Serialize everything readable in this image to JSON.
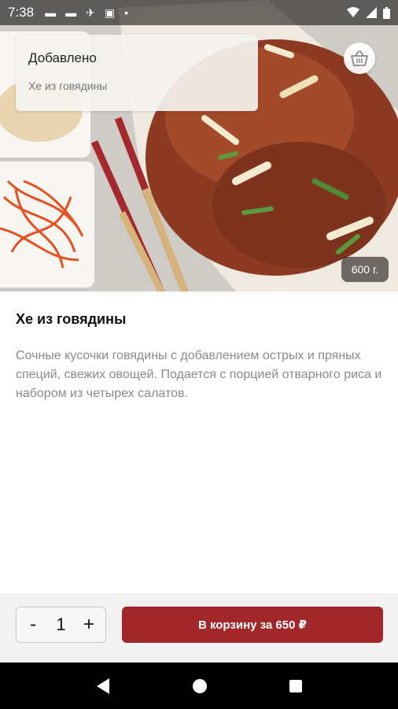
{
  "status_bar": {
    "time": "7:38"
  },
  "toast": {
    "title": "Добавлено",
    "subtitle": "Хе из говядины"
  },
  "hero": {
    "weight": "600 г."
  },
  "product": {
    "title": "Хе из говядины",
    "description": "Сочные кусочки говядины с добавлением острых и пряных специй, свежих овощей. Подается с порцией отварного риса и набором из четырех салатов."
  },
  "order": {
    "minus": "-",
    "quantity": "1",
    "plus": "+",
    "add_to_cart_label": "В корзину за 650 ₽"
  },
  "icons": {
    "basket": "basket-icon",
    "back": "back-icon",
    "home": "home-icon",
    "recents": "recents-icon"
  },
  "colors": {
    "accent": "#a1272a",
    "bottom_bar": "#f2f2f2",
    "nav_bar": "#000000"
  }
}
